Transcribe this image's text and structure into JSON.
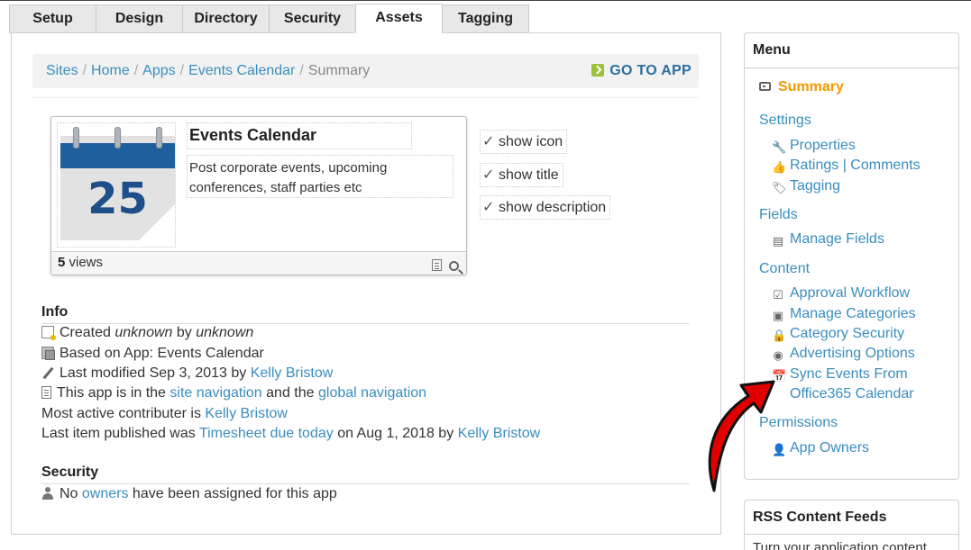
{
  "tabs": [
    "Setup",
    "Design",
    "Directory",
    "Security",
    "Assets",
    "Tagging"
  ],
  "active_tab": "Assets",
  "breadcrumb": {
    "items": [
      "Sites",
      "Home",
      "Apps",
      "Events Calendar"
    ],
    "current": "Summary",
    "go_to_app": "GO TO APP"
  },
  "card": {
    "calendar_number": "25",
    "title": "Events Calendar",
    "description_line1": "Post corporate events, upcoming",
    "description_line2": "conferences, staff parties etc",
    "views_count": "5",
    "views_label": " views"
  },
  "show_options": [
    "show icon",
    "show title",
    "show description"
  ],
  "info": {
    "title": "Info",
    "created_prefix": "Created ",
    "created_date": "unknown",
    "created_by_label": " by ",
    "created_by": "unknown",
    "based_on": "Based on App: Events Calendar",
    "modified_prefix": "Last modified Sep 3, 2013 by ",
    "modified_by": "Kelly Bristow",
    "nav_prefix": "This app is in the ",
    "site_nav": "site navigation",
    "nav_and": " and the ",
    "global_nav": "global navigation",
    "contributor_prefix": "Most active contributer is ",
    "contributor": "Kelly Bristow",
    "published_prefix": "Last item published was ",
    "published_item": "Timesheet due today",
    "published_on": " on Aug 1, 2018 by ",
    "published_by": "Kelly Bristow"
  },
  "security": {
    "title": "Security",
    "prefix": "No ",
    "owners": "owners",
    "suffix": " have been assigned for this app"
  },
  "menu": {
    "title": "Menu",
    "summary": "Summary",
    "settings": "Settings",
    "properties": "Properties",
    "ratings": "Ratings | Comments",
    "tagging": "Tagging",
    "fields": "Fields",
    "manage_fields": "Manage Fields",
    "content": "Content",
    "approval_workflow": "Approval Workflow",
    "manage_categories": "Manage Categories",
    "category_security": "Category Security",
    "advertising_options": "Advertising Options",
    "sync_line1": "Sync Events From",
    "sync_line2": "Office365 Calendar",
    "permissions": "Permissions",
    "app_owners": "App Owners"
  },
  "rss": {
    "title": "RSS Content Feeds",
    "text": "Turn your application content"
  },
  "colors": {
    "link": "#3a8dbf",
    "summary_active": "#f39a00",
    "calendar_blue": "#1e5f9e",
    "go_app_icon": "#9bc23c",
    "arrow_red": "#e00000"
  }
}
